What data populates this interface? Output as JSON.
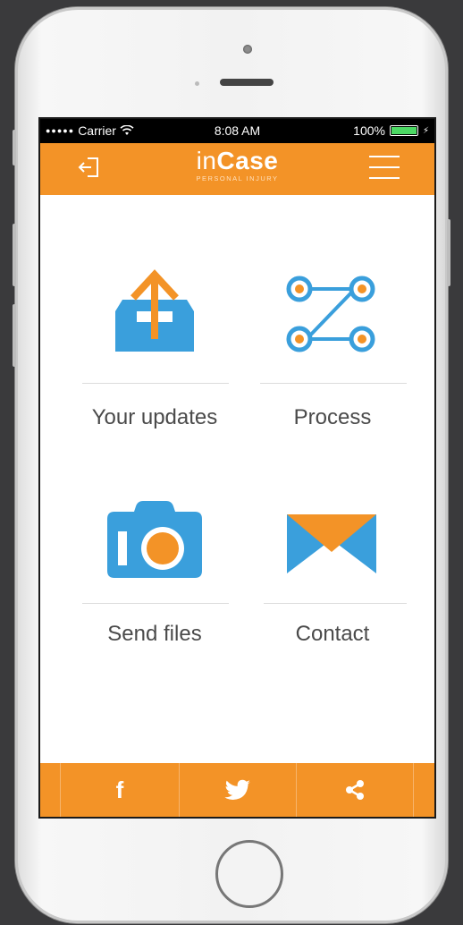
{
  "status_bar": {
    "carrier": "Carrier",
    "time": "8:08 AM",
    "battery": "100%"
  },
  "nav": {
    "brand_part1": "in",
    "brand_part2": "Case",
    "brand_sub": "PERSONAL INJURY",
    "logout_icon": "logout-icon",
    "menu_icon": "hamburger-menu-icon"
  },
  "tiles": [
    {
      "label": "Your updates",
      "icon": "upload-tray-icon"
    },
    {
      "label": "Process",
      "icon": "process-nodes-icon"
    },
    {
      "label": "Send files",
      "icon": "camera-icon"
    },
    {
      "label": "Contact",
      "icon": "envelope-icon"
    }
  ],
  "bottom_bar": {
    "facebook_icon": "facebook-icon",
    "facebook_glyph": "f",
    "twitter_icon": "twitter-icon",
    "share_icon": "share-icon"
  },
  "colors": {
    "accent": "#f39327",
    "icon_blue": "#3a9fdc",
    "icon_orange": "#f39327"
  }
}
